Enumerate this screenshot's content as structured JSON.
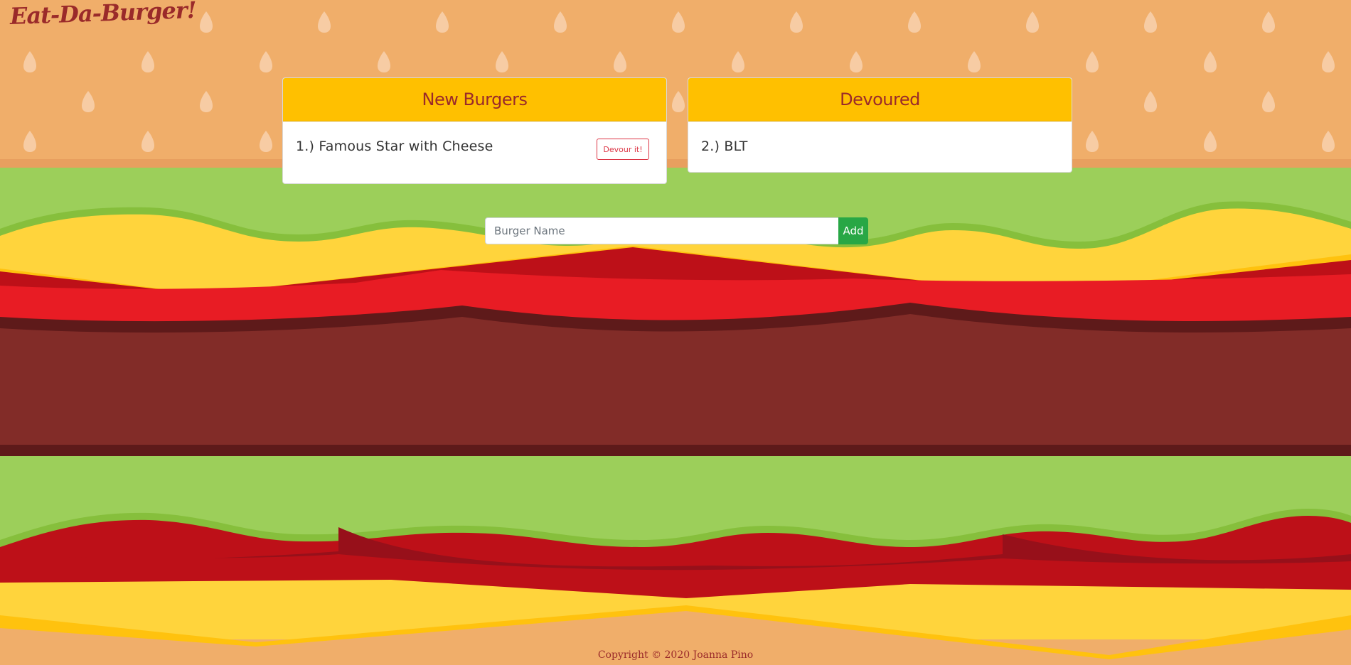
{
  "site": {
    "title": "Eat-Da-Burger!"
  },
  "panels": {
    "new_burgers": {
      "title": "New Burgers",
      "items": [
        {
          "label": "1.) Famous Star with Cheese",
          "button_label": "Devour it!"
        }
      ]
    },
    "devoured": {
      "title": "Devoured",
      "items": [
        {
          "label": "2.) BLT"
        }
      ]
    }
  },
  "form": {
    "input_placeholder": "Burger Name",
    "input_value": "",
    "add_label": "Add"
  },
  "footer": {
    "copyright": "Copyright © 2020 Joanna Pino"
  },
  "colors": {
    "bun": "#f0ae6a",
    "bun_shadow": "#e89f5f",
    "seed": "#f7ccA4",
    "lettuce": "#9ccf5a",
    "lettuce_dark": "#86bf3c",
    "cheese": "#ffd43c",
    "cheese_dark": "#ffc20e",
    "tomato": "#e81c24",
    "tomato_dark": "#bd1018",
    "patty": "#822c28",
    "patty_dark": "#5e1a1a",
    "panel_header": "#ffc000",
    "title_text": "#9a2a2a",
    "add_button": "#28a745",
    "devour_button": "#dc3545"
  }
}
